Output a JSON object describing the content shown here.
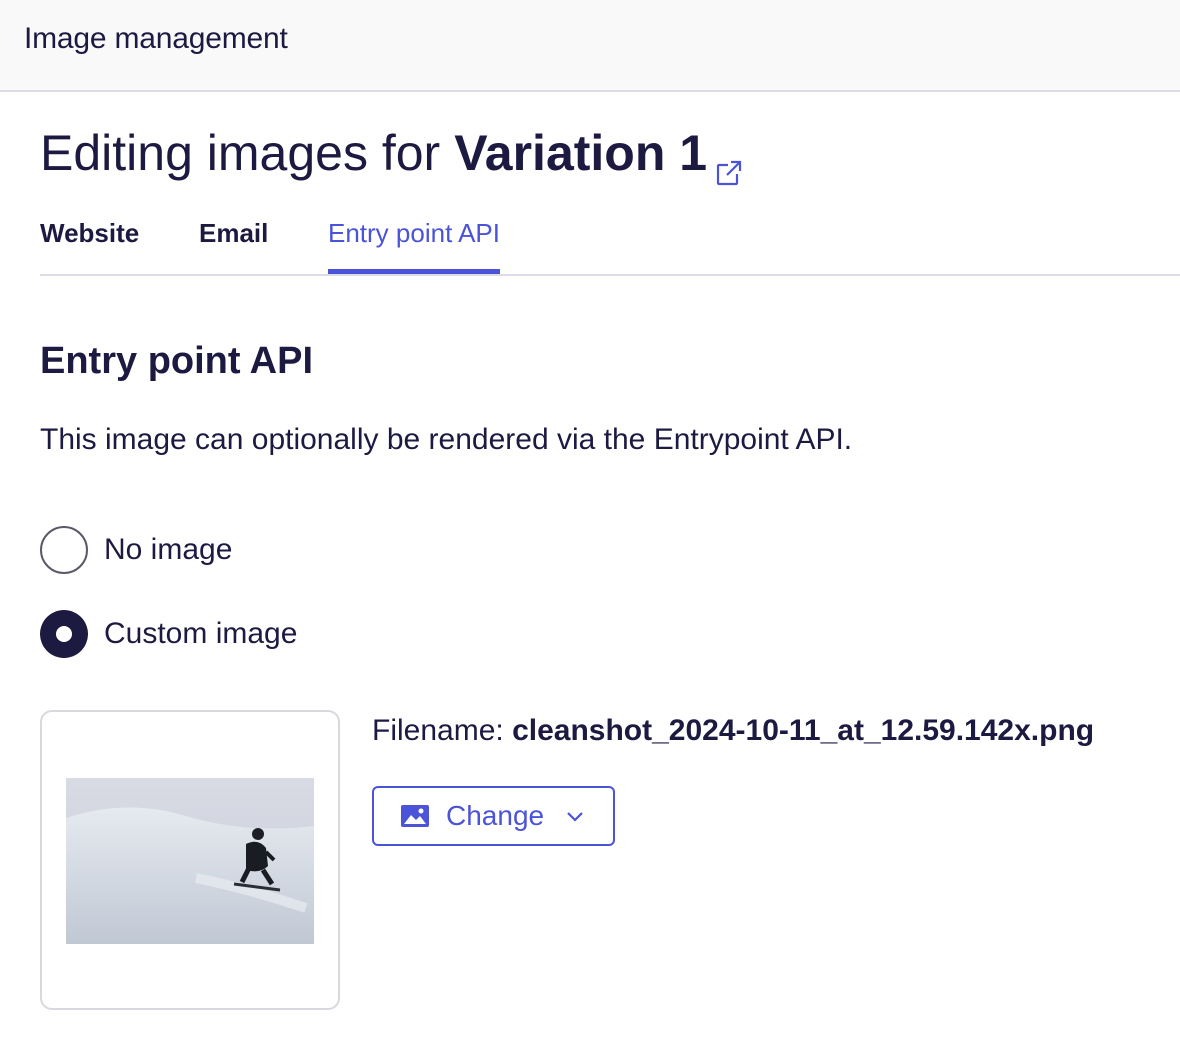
{
  "topbar": {
    "title": "Image management"
  },
  "heading": {
    "prefix": "Editing images for",
    "variation": "Variation 1",
    "external_link_icon": "external-link-icon"
  },
  "tabs": [
    {
      "label": "Website",
      "active": false
    },
    {
      "label": "Email",
      "active": false
    },
    {
      "label": "Entry point API",
      "active": true
    }
  ],
  "section": {
    "title": "Entry point API",
    "description": "This image can optionally be rendered via the Entrypoint API."
  },
  "options": [
    {
      "label": "No image",
      "selected": false
    },
    {
      "label": "Custom image",
      "selected": true
    }
  ],
  "image": {
    "filename_label": "Filename:",
    "filename": "cleanshot_2024-10-11_at_12.59.142x.png",
    "change_label": "Change",
    "change_icon": "image-icon",
    "dropdown_icon": "chevron-down-icon"
  },
  "colors": {
    "text": "#1d1a42",
    "accent": "#4b53d8",
    "topbar_bg": "#f9f9f9",
    "divider": "#dcdce6"
  }
}
